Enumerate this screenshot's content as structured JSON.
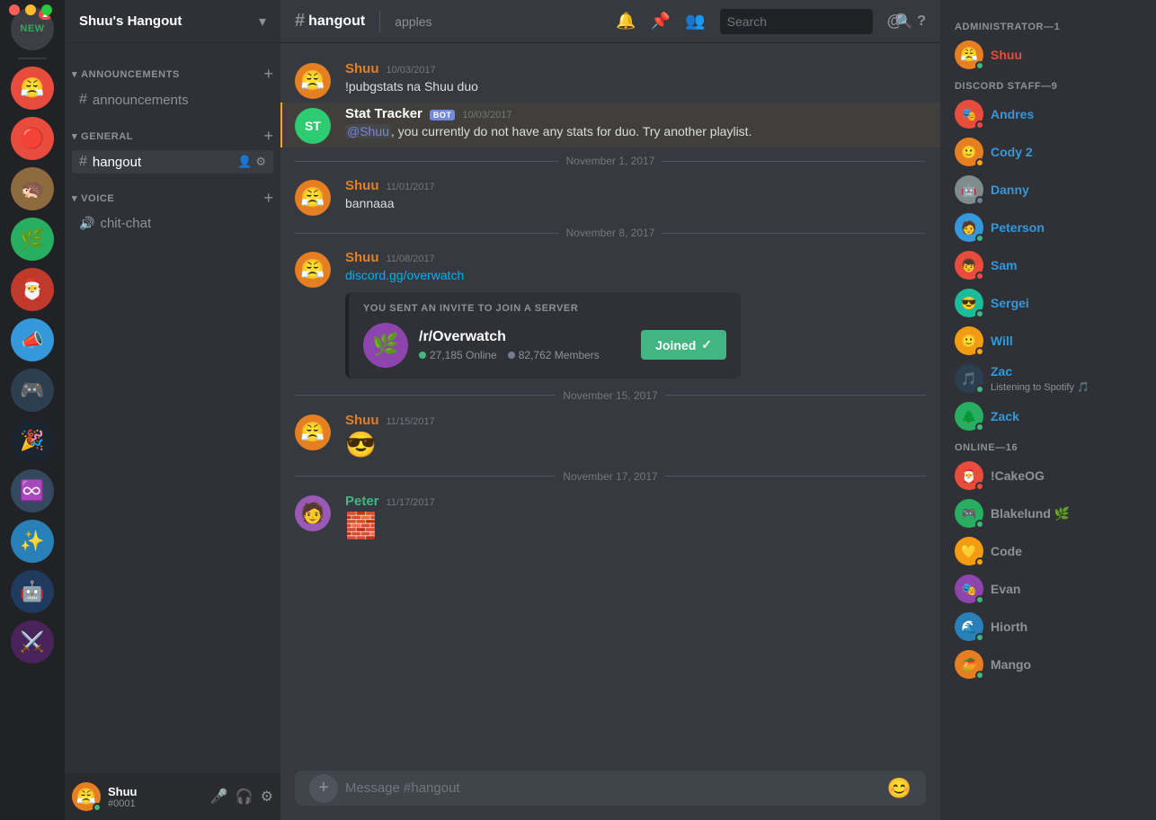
{
  "window": {
    "title": "Shuu's Hangout"
  },
  "server_header": {
    "name": "Shuu's Hangout"
  },
  "channel_categories": [
    {
      "id": "announcements",
      "name": "ANNOUNCEMENTS",
      "channels": [
        {
          "id": "announcements",
          "name": "announcements",
          "type": "text"
        }
      ]
    },
    {
      "id": "general",
      "name": "GENERAL",
      "channels": [
        {
          "id": "hangout",
          "name": "hangout",
          "type": "text",
          "active": true
        }
      ]
    },
    {
      "id": "voice",
      "name": "VOICE",
      "channels": [
        {
          "id": "chit-chat",
          "name": "chit-chat",
          "type": "voice"
        }
      ]
    }
  ],
  "chat": {
    "channel_name": "hangout",
    "channel_topic": "apples",
    "search_placeholder": "Search"
  },
  "messages": [
    {
      "id": "msg1",
      "author": "Shuu",
      "author_type": "shuu",
      "timestamp": "10/03/2017",
      "avatar_color": "#e67e22",
      "avatar_emoji": "😤",
      "content": "!pubgstats na Shuu duo"
    },
    {
      "id": "msg2",
      "author": "Stat Tracker",
      "author_type": "bot",
      "timestamp": "10/03/2017",
      "avatar_bg": "#2ecc71",
      "avatar_text": "ST",
      "bot": true,
      "content_html": "@Shuu, you currently do not have any stats for duo. Try another playlist.",
      "highlighted": true
    },
    {
      "id": "msg3",
      "date_divider": "November 1, 2017"
    },
    {
      "id": "msg4",
      "author": "Shuu",
      "author_type": "shuu",
      "timestamp": "11/01/2017",
      "avatar_color": "#e67e22",
      "content": "bannaaa"
    },
    {
      "id": "msg5",
      "date_divider": "November 8, 2017"
    },
    {
      "id": "msg6",
      "author": "Shuu",
      "author_type": "shuu",
      "timestamp": "11/08/2017",
      "avatar_color": "#e67e22",
      "content": "discord.gg/overwatch",
      "invite": {
        "label": "YOU SENT AN INVITE TO JOIN A SERVER",
        "server_name": "/r/Overwatch",
        "online": "27,185 Online",
        "members": "82,762 Members",
        "button_label": "Joined",
        "button_joined": true
      }
    },
    {
      "id": "msg7",
      "date_divider": "November 15, 2017"
    },
    {
      "id": "msg8",
      "author": "Shuu",
      "author_type": "shuu",
      "timestamp": "11/15/2017",
      "avatar_color": "#e67e22",
      "content_emoji": "😎"
    },
    {
      "id": "msg9",
      "date_divider": "November 17, 2017"
    },
    {
      "id": "msg10",
      "author": "Peter",
      "author_type": "peter",
      "timestamp": "11/17/2017",
      "avatar_color": "#9b59b6",
      "avatar_emoji": "🧑",
      "content_emoji": "🧱"
    }
  ],
  "message_input_placeholder": "Message #hangout",
  "members": {
    "administrator": {
      "header": "ADMINISTRATOR—1",
      "members": [
        {
          "name": "Shuu",
          "status": "online",
          "color": "administrator"
        }
      ]
    },
    "discord_staff": {
      "header": "DISCORD STAFF—9",
      "members": [
        {
          "name": "Andres",
          "status": "dnd",
          "color": "staff"
        },
        {
          "name": "Cody 2",
          "status": "idle",
          "color": "staff"
        },
        {
          "name": "Danny",
          "status": "offline",
          "color": "staff"
        },
        {
          "name": "Peterson",
          "status": "online",
          "color": "staff"
        },
        {
          "name": "Sam",
          "status": "dnd",
          "color": "staff"
        },
        {
          "name": "Sergei",
          "status": "online",
          "color": "staff"
        },
        {
          "name": "Will",
          "status": "idle",
          "color": "staff"
        },
        {
          "name": "Zac",
          "status": "online",
          "color": "staff",
          "subtext": "Listening to Spotify 🎵"
        },
        {
          "name": "Zack",
          "status": "online",
          "color": "staff"
        }
      ]
    },
    "online": {
      "header": "ONLINE—16",
      "members": [
        {
          "name": "!CakeOG",
          "status": "dnd",
          "color": "online"
        },
        {
          "name": "Blakelund 🌿",
          "status": "online",
          "color": "online"
        },
        {
          "name": "Code",
          "status": "idle",
          "color": "online"
        },
        {
          "name": "Evan",
          "status": "online",
          "color": "online"
        },
        {
          "name": "Hiorth",
          "status": "online",
          "color": "online"
        },
        {
          "name": "Mango",
          "status": "online",
          "color": "online"
        }
      ]
    }
  },
  "current_user": {
    "name": "Shuu",
    "discriminator": "#0001",
    "status": "online"
  },
  "icons": {
    "bell": "🔔",
    "pin": "📌",
    "members": "👥",
    "at": "@",
    "question": "?",
    "search": "🔍",
    "mic": "🎤",
    "headset": "🎧",
    "settings": "⚙️",
    "add": "+",
    "hash": "#",
    "speaker": "🔊",
    "chevron_down": "▾",
    "chevron_right": "▸",
    "user_add": "👤+",
    "gear": "⚙",
    "smile": "😊"
  }
}
